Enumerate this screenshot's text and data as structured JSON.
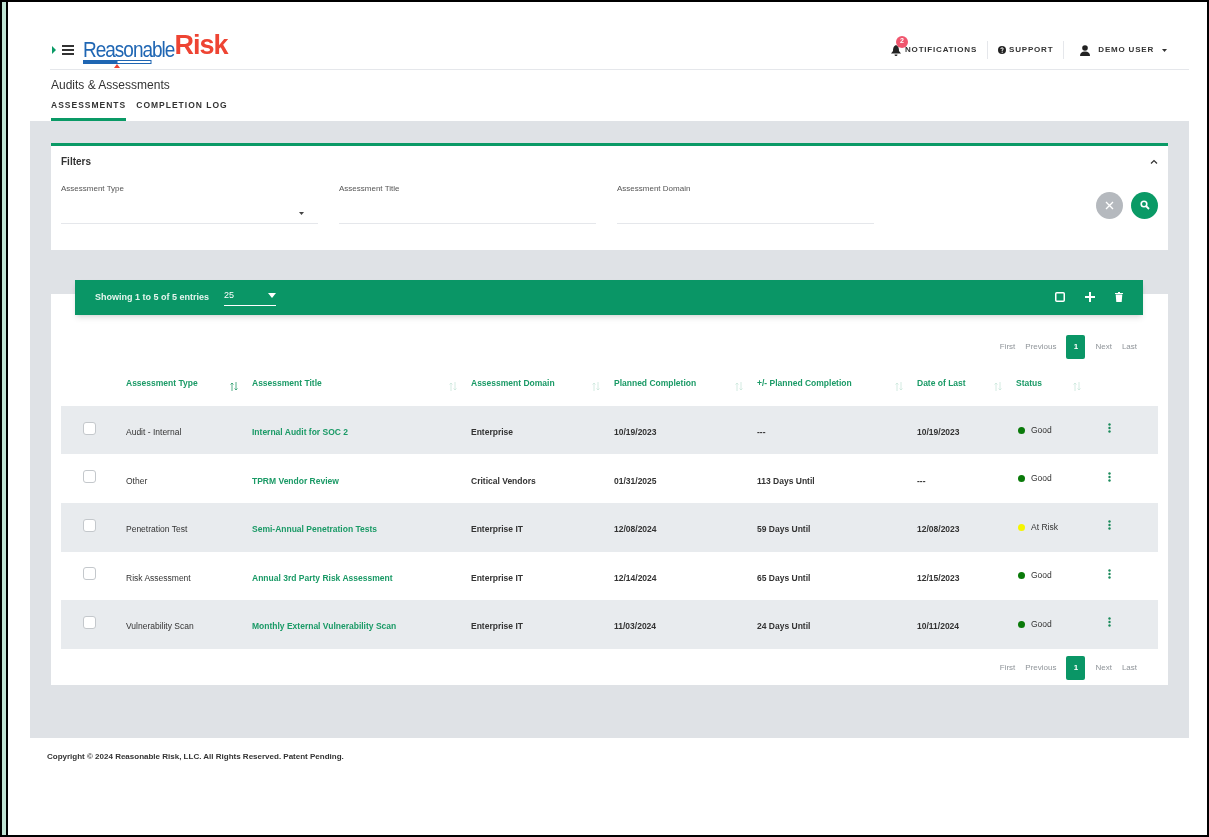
{
  "header": {
    "logo": {
      "part_1": "Reasonable",
      "part_2": "Risk"
    },
    "notifications": {
      "label": "NOTIFICATIONS",
      "badge": "2"
    },
    "support": "SUPPORT",
    "user": "DEMO USER"
  },
  "page": {
    "title": "Audits & Assessments",
    "tabs": [
      {
        "label": "ASSESSMENTS",
        "selected": true
      },
      {
        "label": "COMPLETION LOG",
        "selected": false
      }
    ]
  },
  "filters": {
    "title": "Filters",
    "fields": [
      {
        "label": "Assessment Type",
        "kind": "select"
      },
      {
        "label": "Assessment Title",
        "kind": "text"
      },
      {
        "label": "Assessment Domain",
        "kind": "text"
      }
    ]
  },
  "toolbar": {
    "showing": "Showing 1 to 5 of 5 entries",
    "page_size": "25"
  },
  "pagination_top": [
    {
      "label": "First",
      "disabled": true,
      "selected": false
    },
    {
      "label": "Previous",
      "disabled": true,
      "selected": false
    },
    {
      "label": "1",
      "selected": true
    },
    {
      "label": "Next",
      "disabled": true,
      "selected": false
    },
    {
      "label": "Last",
      "disabled": true,
      "selected": false
    }
  ],
  "table": {
    "columns": [
      {
        "label": "Assessment Type",
        "sorted": true
      },
      {
        "label": "Assessment Title",
        "sorted": false
      },
      {
        "label": "Assessment Domain",
        "sorted": false
      },
      {
        "label": "Planned Completion",
        "sorted": false
      },
      {
        "label": "+/- Planned Completion",
        "sorted": false
      },
      {
        "label": "Date of Last",
        "sorted": false
      },
      {
        "label": "Status",
        "sorted": false
      }
    ],
    "rows": [
      {
        "checked": false,
        "type": "Audit - Internal",
        "title": "Internal Audit for SOC 2",
        "domain": "Enterprise",
        "planned": "10/19/2023",
        "delta": "---",
        "last": "10/19/2023",
        "status": "Good",
        "color": "#0a7a0a"
      },
      {
        "checked": false,
        "type": "Other",
        "title": "TPRM Vendor Review",
        "domain": "Critical Vendors",
        "planned": "01/31/2025",
        "delta": "113 Days Until",
        "last": "---",
        "status": "Good",
        "color": "#0a7a0a"
      },
      {
        "checked": false,
        "type": "Penetration Test",
        "title": "Semi-Annual Penetration Tests",
        "domain": "Enterprise IT",
        "planned": "12/08/2024",
        "delta": "59 Days Until",
        "last": "12/08/2023",
        "status": "At Risk",
        "color": "#f5f500"
      },
      {
        "checked": false,
        "type": "Risk Assessment",
        "title": "Annual 3rd Party Risk Assessment",
        "domain": "Enterprise IT",
        "planned": "12/14/2024",
        "delta": "65 Days Until",
        "last": "12/15/2023",
        "status": "Good",
        "color": "#0a7a0a"
      },
      {
        "checked": false,
        "type": "Vulnerability Scan",
        "title": "Monthly External Vulnerability Scan",
        "domain": "Enterprise IT",
        "planned": "11/03/2024",
        "delta": "24 Days Until",
        "last": "10/11/2024",
        "status": "Good",
        "color": "#0a7a0a"
      }
    ]
  },
  "pagination_bottom": [
    {
      "label": "First",
      "disabled": true,
      "selected": false
    },
    {
      "label": "Previous",
      "disabled": true,
      "selected": false
    },
    {
      "label": "1",
      "selected": true
    },
    {
      "label": "Next",
      "disabled": true,
      "selected": false
    },
    {
      "label": "Last",
      "disabled": true,
      "selected": false
    }
  ],
  "footer": "Copyright © 2024 Reasonable Risk, LLC. All Rights Reserved. Patent Pending."
}
